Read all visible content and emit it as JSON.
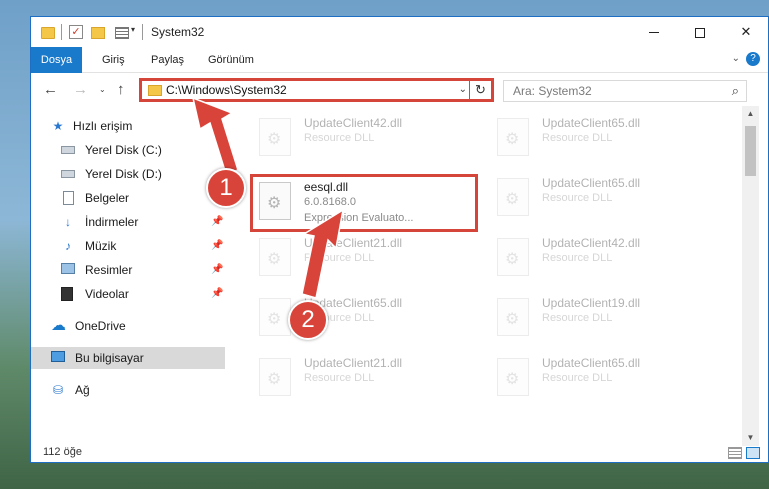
{
  "window": {
    "title": "System32",
    "controls": {
      "minimize": "",
      "maximize": "",
      "close": "✕"
    }
  },
  "quick_access": {
    "checkmark": "✓",
    "dropdown": "▾"
  },
  "ribbon": {
    "tabs": [
      {
        "label": "Dosya"
      },
      {
        "label": "Giriş"
      },
      {
        "label": "Paylaş"
      },
      {
        "label": "Görünüm"
      }
    ],
    "chevron": "⌄",
    "help": "?"
  },
  "nav": {
    "back": "←",
    "forward": "→",
    "recent": "⌄",
    "up": "↑",
    "address": "C:\\Windows\\System32",
    "address_dropdown": "⌄",
    "refresh": "↻",
    "search_placeholder": "Ara: System32",
    "search_glyph": "⌕"
  },
  "sidebar": {
    "items": [
      {
        "label": "Hızlı erişim",
        "icon": "star-icon",
        "glyph": "★"
      },
      {
        "label": "Yerel Disk (C:)",
        "icon": "drive-icon",
        "glyph": ""
      },
      {
        "label": "Yerel Disk (D:)",
        "icon": "drive-icon",
        "glyph": ""
      },
      {
        "label": "Belgeler",
        "icon": "documents-icon",
        "glyph": ""
      },
      {
        "label": "İndirmeler",
        "icon": "download-icon",
        "glyph": "↓"
      },
      {
        "label": "Müzik",
        "icon": "music-icon",
        "glyph": "♪"
      },
      {
        "label": "Resimler",
        "icon": "pictures-icon",
        "glyph": ""
      },
      {
        "label": "Videolar",
        "icon": "videos-icon",
        "glyph": ""
      },
      {
        "label": "OneDrive",
        "icon": "cloud-icon",
        "glyph": "☁"
      },
      {
        "label": "Bu bilgisayar",
        "icon": "computer-icon",
        "glyph": ""
      },
      {
        "label": "Ağ",
        "icon": "network-icon",
        "glyph": "⛁"
      }
    ],
    "pin_glyph": "📌"
  },
  "files": {
    "left": [
      {
        "name": "UpdateClient42.dll",
        "desc": "Resource DLL"
      },
      {
        "name": "eesql.dll",
        "desc": "6.0.8168.0",
        "desc2": "Expression Evaluato..."
      },
      {
        "name": "UpdateClient21.dll",
        "desc": "Resource DLL"
      },
      {
        "name": "UpdateClient65.dll",
        "desc": "Resource DLL"
      },
      {
        "name": "UpdateClient21.dll",
        "desc": "Resource DLL"
      }
    ],
    "right": [
      {
        "name": "UpdateClient65.dll",
        "desc": "Resource DLL"
      },
      {
        "name": "UpdateClient65.dll",
        "desc": "Resource DLL"
      },
      {
        "name": "UpdateClient42.dll",
        "desc": "Resource DLL"
      },
      {
        "name": "UpdateClient19.dll",
        "desc": "Resource DLL"
      },
      {
        "name": "UpdateClient65.dll",
        "desc": "Resource DLL"
      }
    ]
  },
  "scrollbar": {
    "up": "▲",
    "down": "▼"
  },
  "status": {
    "item_count": "112 öğe"
  },
  "annotations": {
    "step1": "1",
    "step2": "2"
  },
  "colors": {
    "accent": "#1979ca",
    "highlight": "#d6453a",
    "badge": "#d9443a"
  }
}
